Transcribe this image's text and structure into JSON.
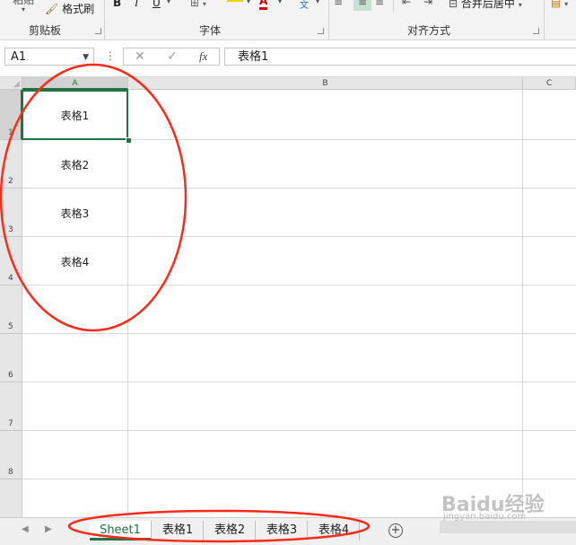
{
  "ribbon": {
    "clipboard": {
      "paste_partial": "粘贴",
      "format_painter": "格式刷",
      "group_label": "剪贴板"
    },
    "font": {
      "bold": "B",
      "italic": "I",
      "underline": "U",
      "font_color": "A",
      "group_label": "字体"
    },
    "alignment": {
      "merge_center": "合并后居中",
      "group_label": "对齐方式"
    }
  },
  "formula_bar": {
    "name_box": "A1",
    "cancel": "✕",
    "enter": "✓",
    "fx": "fx",
    "value": "表格1"
  },
  "sheet": {
    "columns": [
      "A",
      "B",
      "C"
    ],
    "rows": [
      "1",
      "2",
      "3",
      "4",
      "5",
      "6",
      "7",
      "8"
    ],
    "cells": [
      "表格1",
      "表格2",
      "表格3",
      "表格4"
    ],
    "active_cell": "A1"
  },
  "tabs": {
    "items": [
      "Sheet1",
      "表格1",
      "表格2",
      "表格3",
      "表格4"
    ],
    "active": "Sheet1",
    "nav_prev": "◀",
    "nav_next": "▶",
    "add": "+"
  },
  "colors": {
    "accent": "#217346",
    "annotation": "#ff2a1a"
  },
  "watermark": {
    "logo": "Baidu经验",
    "url": "jingyan.baidu.com"
  }
}
